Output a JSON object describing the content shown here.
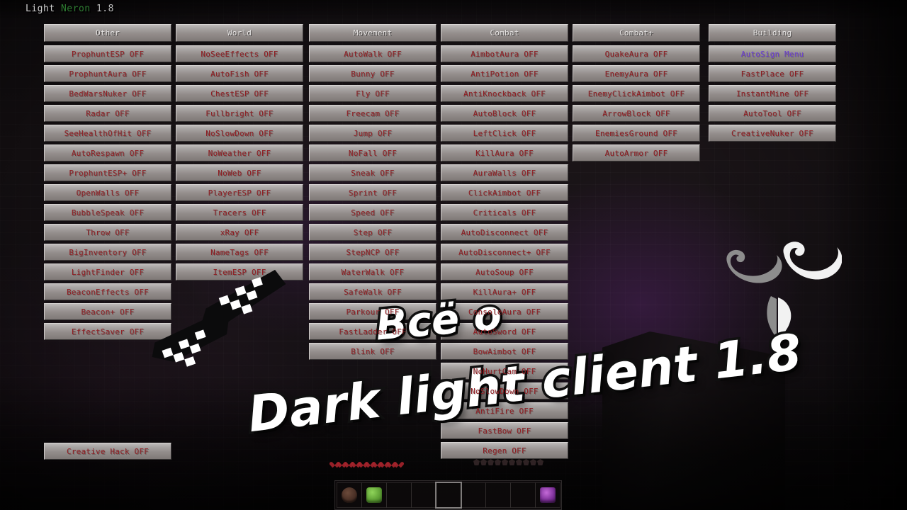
{
  "watermark": {
    "client_name": "Light",
    "brand": "Neron",
    "version": "1.8",
    "brand_color": "#2e7d32",
    "name_color": "#cfcfcf"
  },
  "colors": {
    "module_off": "#8f1d22",
    "module_menu": "#6b3fd4",
    "category_header": "#e8e6e5",
    "button_face": "#a7a3a2"
  },
  "columns": [
    {
      "header": "Other",
      "modules": [
        {
          "label": "ProphuntESP OFF",
          "state": "off"
        },
        {
          "label": "ProphuntAura OFF",
          "state": "off"
        },
        {
          "label": "BedWarsNuker OFF",
          "state": "off"
        },
        {
          "label": "Radar OFF",
          "state": "off"
        },
        {
          "label": "SeeHealthOfHit OFF",
          "state": "off"
        },
        {
          "label": "AutoRespawn OFF",
          "state": "off"
        },
        {
          "label": "ProphuntESP+ OFF",
          "state": "off"
        },
        {
          "label": "OpenWalls OFF",
          "state": "off"
        },
        {
          "label": "BubbleSpeak OFF",
          "state": "off"
        },
        {
          "label": "Throw OFF",
          "state": "off"
        },
        {
          "label": "BigInventory OFF",
          "state": "off"
        },
        {
          "label": "LightFinder OFF",
          "state": "off"
        },
        {
          "label": "BeaconEffects OFF",
          "state": "off"
        },
        {
          "label": "Beacon+ OFF",
          "state": "off"
        },
        {
          "label": "EffectSaver OFF",
          "state": "off"
        }
      ]
    },
    {
      "header": "World",
      "modules": [
        {
          "label": "NoSeeEffects OFF",
          "state": "off"
        },
        {
          "label": "AutoFish OFF",
          "state": "off"
        },
        {
          "label": "ChestESP OFF",
          "state": "off"
        },
        {
          "label": "Fullbright OFF",
          "state": "off"
        },
        {
          "label": "NoSlowDown OFF",
          "state": "off"
        },
        {
          "label": "NoWeather OFF",
          "state": "off"
        },
        {
          "label": "NoWeb OFF",
          "state": "off"
        },
        {
          "label": "PlayerESP OFF",
          "state": "off"
        },
        {
          "label": "Tracers OFF",
          "state": "off"
        },
        {
          "label": "xRay OFF",
          "state": "off"
        },
        {
          "label": "NameTags OFF",
          "state": "off"
        },
        {
          "label": "ItemESP OFF",
          "state": "off"
        }
      ]
    },
    {
      "header": "Movement",
      "modules": [
        {
          "label": "AutoWalk OFF",
          "state": "off"
        },
        {
          "label": "Bunny OFF",
          "state": "off"
        },
        {
          "label": "Fly OFF",
          "state": "off"
        },
        {
          "label": "Freecam OFF",
          "state": "off"
        },
        {
          "label": "Jump OFF",
          "state": "off"
        },
        {
          "label": "NoFall OFF",
          "state": "off"
        },
        {
          "label": "Sneak OFF",
          "state": "off"
        },
        {
          "label": "Sprint OFF",
          "state": "off"
        },
        {
          "label": "Speed OFF",
          "state": "off"
        },
        {
          "label": "Step OFF",
          "state": "off"
        },
        {
          "label": "StepNCP OFF",
          "state": "off"
        },
        {
          "label": "WaterWalk OFF",
          "state": "off"
        },
        {
          "label": "SafeWalk OFF",
          "state": "off"
        },
        {
          "label": "Parkour OFF",
          "state": "off"
        },
        {
          "label": "FastLadder OFF",
          "state": "off"
        },
        {
          "label": "Blink OFF",
          "state": "off"
        }
      ]
    },
    {
      "header": "Combat",
      "modules": [
        {
          "label": "AimbotAura OFF",
          "state": "off"
        },
        {
          "label": "AntiPotion OFF",
          "state": "off"
        },
        {
          "label": "AntiKnockback OFF",
          "state": "off"
        },
        {
          "label": "AutoBlock OFF",
          "state": "off"
        },
        {
          "label": "LeftClick OFF",
          "state": "off"
        },
        {
          "label": "KillAura OFF",
          "state": "off"
        },
        {
          "label": "AuraWalls OFF",
          "state": "off"
        },
        {
          "label": "ClickAimbot OFF",
          "state": "off"
        },
        {
          "label": "Criticals OFF",
          "state": "off"
        },
        {
          "label": "AutoDisconnect OFF",
          "state": "off"
        },
        {
          "label": "AutoDisconnect+ OFF",
          "state": "off"
        },
        {
          "label": "AutoSoup OFF",
          "state": "off"
        },
        {
          "label": "KillAura+ OFF",
          "state": "off"
        },
        {
          "label": "ConsoleAura OFF",
          "state": "off"
        },
        {
          "label": "AutoSword OFF",
          "state": "off"
        },
        {
          "label": "BowAimbot OFF",
          "state": "off"
        },
        {
          "label": "NoHurtCam OFF",
          "state": "off"
        },
        {
          "label": "NoSlowDown OFF",
          "state": "off"
        },
        {
          "label": "AntiFire OFF",
          "state": "off"
        },
        {
          "label": "FastBow OFF",
          "state": "off"
        },
        {
          "label": "Regen OFF",
          "state": "off"
        }
      ]
    },
    {
      "header": "Combat+",
      "modules": [
        {
          "label": "QuakeAura OFF",
          "state": "off"
        },
        {
          "label": "EnemyAura OFF",
          "state": "off"
        },
        {
          "label": "EnemyClickAimbot OFF",
          "state": "off"
        },
        {
          "label": "ArrowBlock OFF",
          "state": "off"
        },
        {
          "label": "EnemiesGround OFF",
          "state": "off"
        },
        {
          "label": "AutoArmor OFF",
          "state": "off"
        }
      ]
    },
    {
      "header": "Building",
      "modules": [
        {
          "label": "AutoSign Menu",
          "state": "menu"
        },
        {
          "label": "FastPlace OFF",
          "state": "off"
        },
        {
          "label": "InstantMine OFF",
          "state": "off"
        },
        {
          "label": "AutoTool OFF",
          "state": "off"
        },
        {
          "label": "CreativeNuker OFF",
          "state": "off"
        }
      ]
    }
  ],
  "standalone_module": {
    "label": "Creative Hack OFF",
    "state": "off"
  },
  "overlay": {
    "line1": "Всё о",
    "line2": "Dark light client 1.8"
  },
  "hud": {
    "hearts": 10,
    "armor": 10,
    "hotbar": {
      "selected_slot": 5,
      "slots": [
        {
          "item": "bowl-item"
        },
        {
          "item": "slime-item"
        },
        {
          "item": ""
        },
        {
          "item": ""
        },
        {
          "item": ""
        },
        {
          "item": ""
        },
        {
          "item": ""
        },
        {
          "item": ""
        },
        {
          "item": "ender-item"
        }
      ]
    }
  },
  "stickers": {
    "glasses": "thug-life-glasses-sticker",
    "mustache": "mustache-sticker",
    "goatee": "goatee-sticker"
  }
}
